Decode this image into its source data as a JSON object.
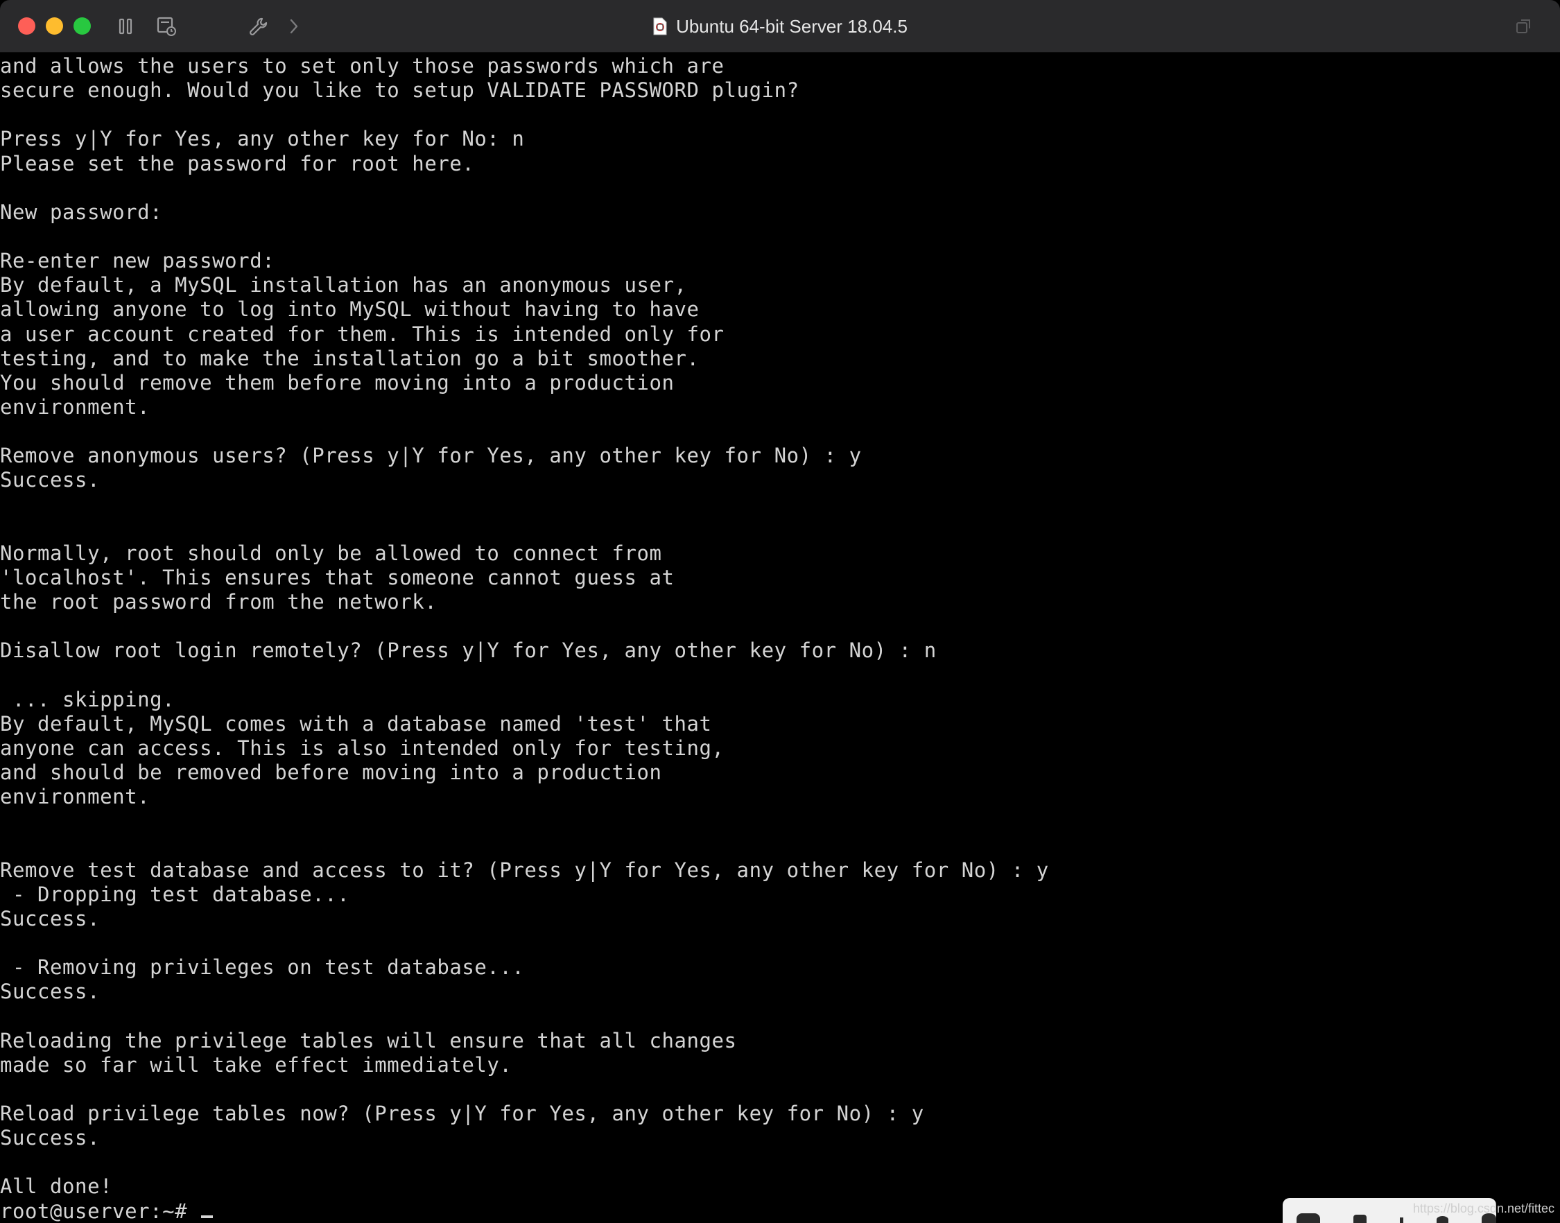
{
  "window": {
    "title": "Ubuntu 64-bit Server 18.04.5"
  },
  "toolbar": {
    "icons": [
      "pause-icon",
      "snapshot-icon",
      "settings-wrench-icon",
      "forward-chevron-icon"
    ]
  },
  "terminal": {
    "lines": [
      "and allows the users to set only those passwords which are",
      "secure enough. Would you like to setup VALIDATE PASSWORD plugin?",
      "",
      "Press y|Y for Yes, any other key for No: n",
      "Please set the password for root here.",
      "",
      "New password:",
      "",
      "Re-enter new password:",
      "By default, a MySQL installation has an anonymous user,",
      "allowing anyone to log into MySQL without having to have",
      "a user account created for them. This is intended only for",
      "testing, and to make the installation go a bit smoother.",
      "You should remove them before moving into a production",
      "environment.",
      "",
      "Remove anonymous users? (Press y|Y for Yes, any other key for No) : y",
      "Success.",
      "",
      "",
      "Normally, root should only be allowed to connect from",
      "'localhost'. This ensures that someone cannot guess at",
      "the root password from the network.",
      "",
      "Disallow root login remotely? (Press y|Y for Yes, any other key for No) : n",
      "",
      " ... skipping.",
      "By default, MySQL comes with a database named 'test' that",
      "anyone can access. This is also intended only for testing,",
      "and should be removed before moving into a production",
      "environment.",
      "",
      "",
      "Remove test database and access to it? (Press y|Y for Yes, any other key for No) : y",
      " - Dropping test database...",
      "Success.",
      "",
      " - Removing privileges on test database...",
      "Success.",
      "",
      "Reloading the privilege tables will ensure that all changes",
      "made so far will take effect immediately.",
      "",
      "Reload privilege tables now? (Press y|Y for Yes, any other key for No) : y",
      "Success.",
      "",
      "All done!"
    ],
    "prompt": "root@userver:~# "
  },
  "colors": {
    "terminal_bg": "#000000",
    "terminal_fg": "#d4d4d4",
    "titlebar_bg": "#2a2a2c"
  },
  "watermark": "https://blog.csdn.net/fittec"
}
